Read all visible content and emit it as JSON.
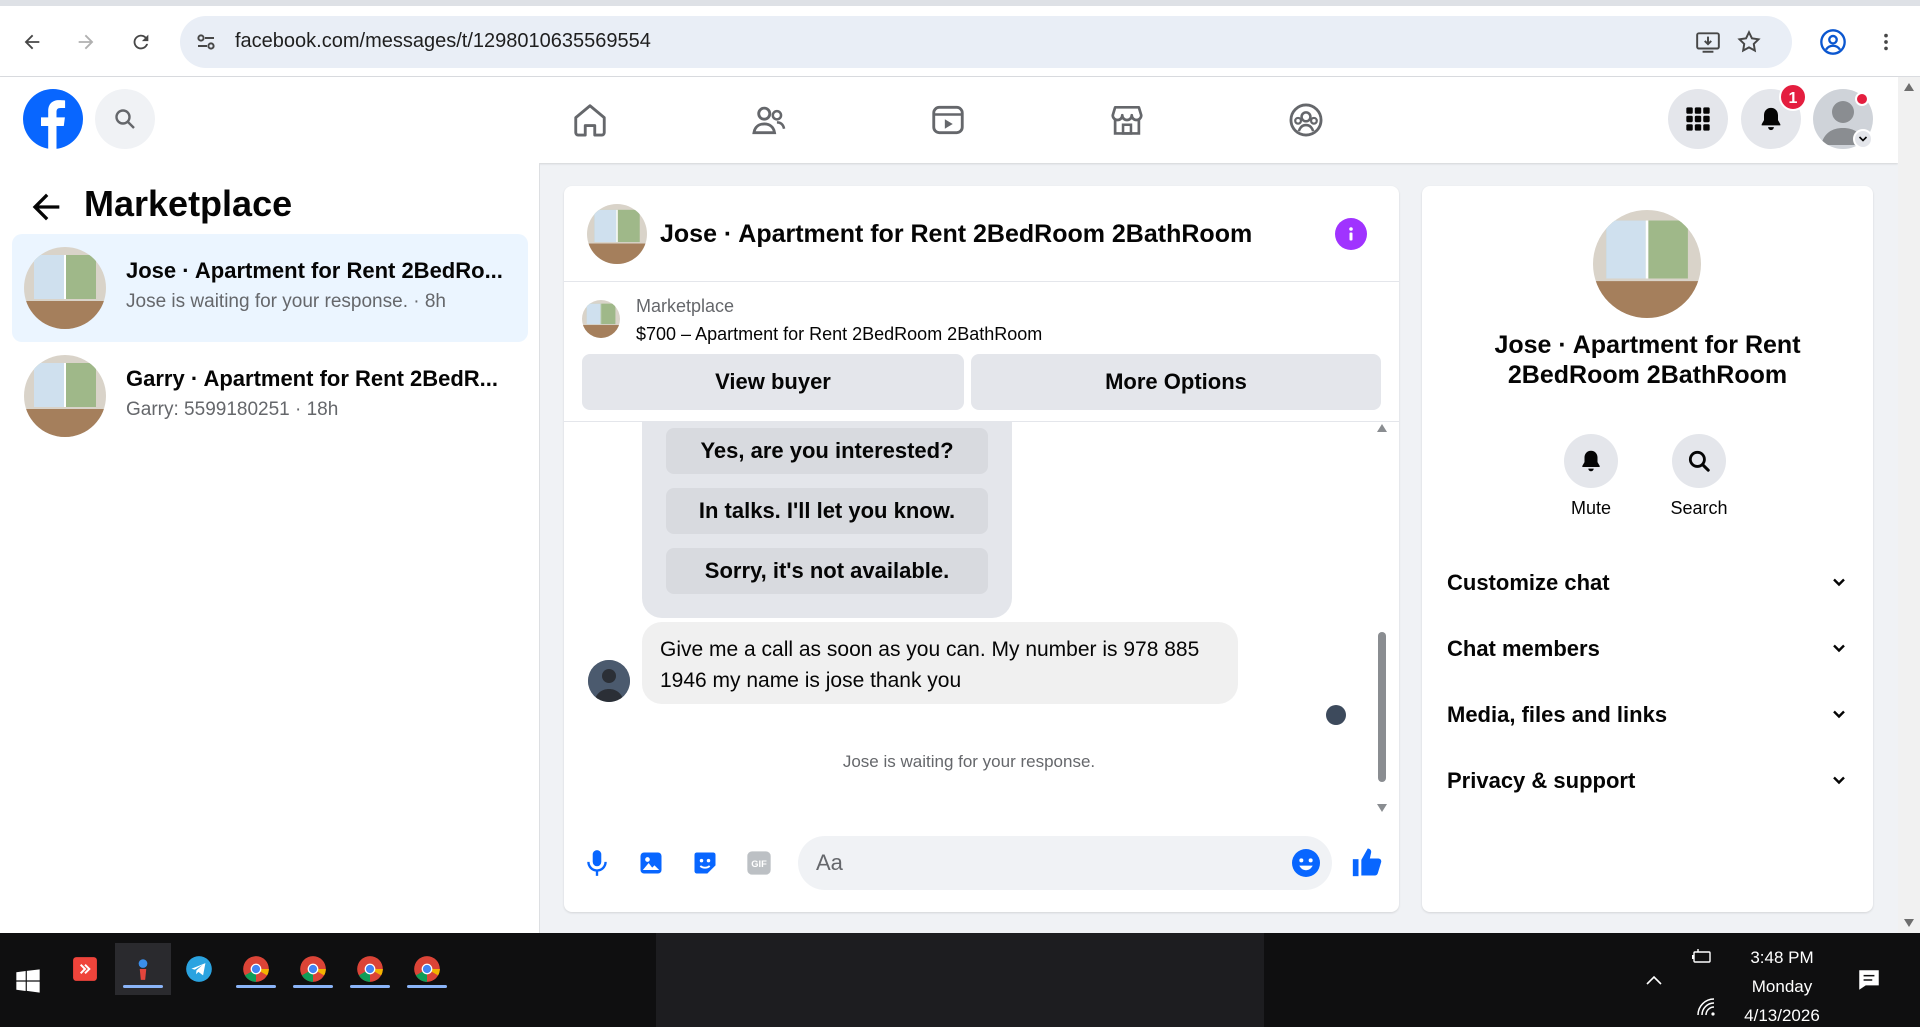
{
  "browser": {
    "url": "facebook.com/messages/t/1298010635569554"
  },
  "facebook": {
    "notifications_badge": "1"
  },
  "chat_list": {
    "title": "Marketplace",
    "items": [
      {
        "title": "Jose · Apartment for Rent 2BedRo...",
        "subtitle": "Jose is waiting for your response. · 8h",
        "active": true
      },
      {
        "title": "Garry · Apartment for Rent 2BedR...",
        "subtitle": "Garry: 5599180251 · 18h",
        "active": false
      }
    ]
  },
  "conversation": {
    "title": "Jose · Apartment for Rent 2BedRoom 2BathRoom",
    "listing": {
      "source": "Marketplace",
      "price_title": "$700 – Apartment for Rent 2BedRoom 2BathRoom",
      "view_buyer_label": "View buyer",
      "more_options_label": "More Options"
    },
    "quick_replies": [
      "Yes, are you interested?",
      "In talks. I'll let you know.",
      "Sorry, it's not available."
    ],
    "message": "Give me a call as soon as you can. My number is 978 885 1946 my name is jose thank you",
    "status": "Jose is waiting for your response.",
    "composer_placeholder": "Aa"
  },
  "info_panel": {
    "title": "Jose · Apartment for Rent 2BedRoom 2BathRoom",
    "actions": [
      {
        "label": "Mute",
        "icon": "bell-icon"
      },
      {
        "label": "Search",
        "icon": "search-icon"
      }
    ],
    "sections": [
      "Customize chat",
      "Chat members",
      "Media, files and links",
      "Privacy & support"
    ]
  },
  "taskbar": {
    "time": "3:48 PM",
    "day": "Monday",
    "date": "4/13/2026"
  },
  "colors": {
    "fb_blue": "#0866ff",
    "active_chat_bg": "#ebf5ff",
    "info_purple": "#a033ff",
    "badge_red": "#e41e3f"
  }
}
